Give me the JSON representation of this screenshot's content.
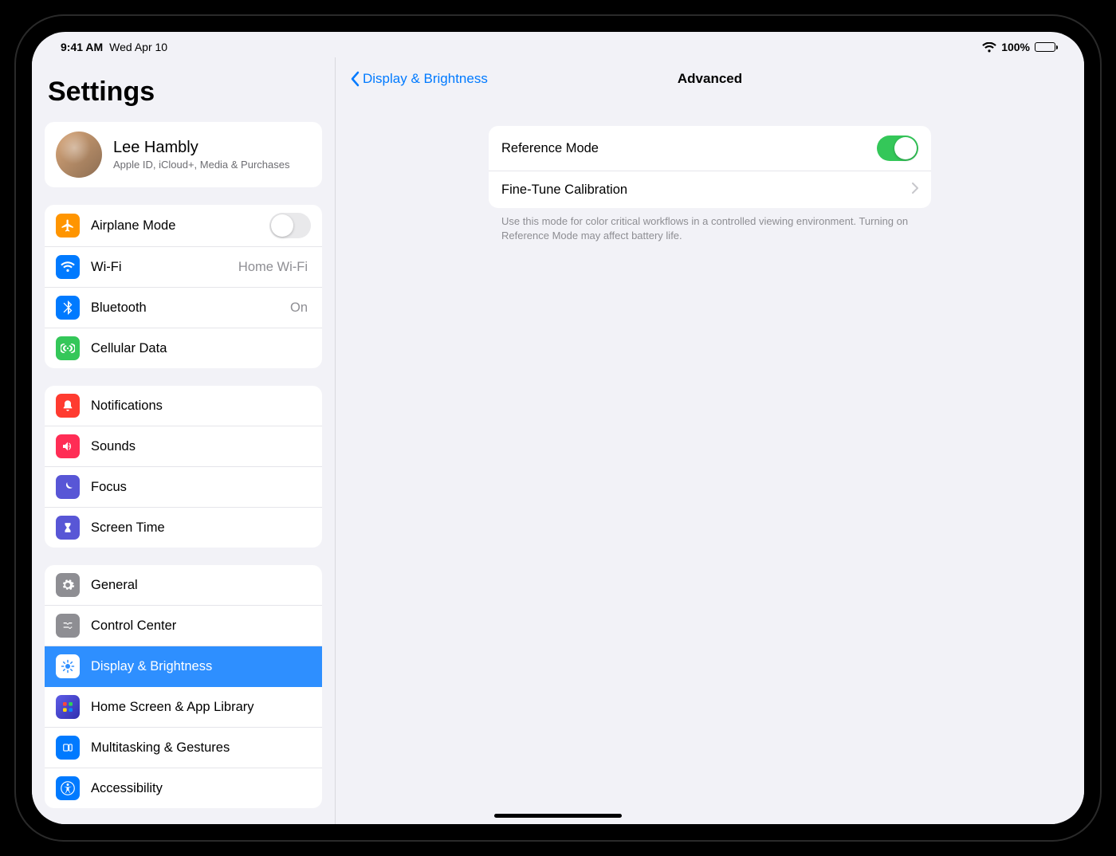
{
  "status": {
    "time": "9:41 AM",
    "date": "Wed Apr 10",
    "battery_pct": "100%"
  },
  "sidebar": {
    "title": "Settings",
    "profile": {
      "name": "Lee Hambly",
      "sub": "Apple ID, iCloud+, Media & Purchases"
    },
    "group1": {
      "airplane": "Airplane Mode",
      "wifi": "Wi-Fi",
      "wifi_value": "Home Wi-Fi",
      "bluetooth": "Bluetooth",
      "bluetooth_value": "On",
      "cellular": "Cellular Data"
    },
    "group2": {
      "notifications": "Notifications",
      "sounds": "Sounds",
      "focus": "Focus",
      "screen_time": "Screen Time"
    },
    "group3": {
      "general": "General",
      "control_center": "Control Center",
      "display": "Display & Brightness",
      "home_screen": "Home Screen & App Library",
      "multitasking": "Multitasking & Gestures",
      "accessibility": "Accessibility"
    }
  },
  "detail": {
    "back_label": "Display & Brightness",
    "title": "Advanced",
    "reference_mode_label": "Reference Mode",
    "calibration_label": "Fine-Tune Calibration",
    "footer": "Use this mode for color critical workflows in a controlled viewing environment. Turning on Reference Mode may affect battery life."
  },
  "icons": {
    "airplane": "#ff9500",
    "wifi": "#007aff",
    "bluetooth": "#007aff",
    "cellular": "#34c759",
    "notifications": "#ff3b30",
    "sounds": "#ff2d55",
    "focus": "#5856d6",
    "screen_time": "#5856d6",
    "general": "#8e8e93",
    "control_center": "#8e8e93",
    "display": "#007aff",
    "home_screen": "#4b3fae",
    "multitasking": "#007aff",
    "accessibility": "#007aff"
  }
}
